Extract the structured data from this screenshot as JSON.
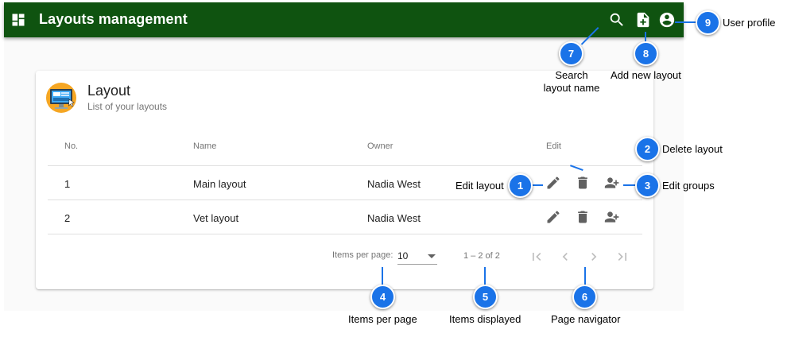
{
  "app": {
    "title": "Layouts management",
    "header_color": "#0f5310",
    "icons": [
      "dashboard-icon",
      "search-icon",
      "add-document-icon",
      "account-circle-icon"
    ]
  },
  "card": {
    "title": "Layout",
    "subtitle": "List of your layouts",
    "logo_icon": "monitor-layout-icon"
  },
  "table": {
    "columns": [
      "No.",
      "Name",
      "Owner",
      "Edit"
    ],
    "rows": [
      {
        "no": "1",
        "name": "Main layout",
        "owner": "Nadia West"
      },
      {
        "no": "2",
        "name": "Vet layout",
        "owner": "Nadia West"
      }
    ],
    "row_actions": [
      "edit-pencil-icon",
      "delete-trash-icon",
      "edit-groups-icon"
    ]
  },
  "paginator": {
    "items_per_page_label": "Items per page:",
    "items_per_page_value": "10",
    "range_label": "1 – 2 of 2",
    "buttons": [
      "first-page-icon",
      "previous-page-icon",
      "next-page-icon",
      "last-page-icon"
    ]
  },
  "annotations": {
    "c1": {
      "num": "1",
      "text": "Edit layout"
    },
    "c2": {
      "num": "2",
      "text": "Delete layout"
    },
    "c3": {
      "num": "3",
      "text": "Edit groups"
    },
    "c4": {
      "num": "4",
      "text": "Items per page"
    },
    "c5": {
      "num": "5",
      "text": "Items displayed"
    },
    "c6": {
      "num": "6",
      "text": "Page navigator"
    },
    "c7": {
      "num": "7",
      "text": "Search layout name"
    },
    "c8": {
      "num": "8",
      "text": "Add new layout"
    },
    "c9": {
      "num": "9",
      "text": "User profile"
    },
    "callout_color": "#1a73e8"
  }
}
